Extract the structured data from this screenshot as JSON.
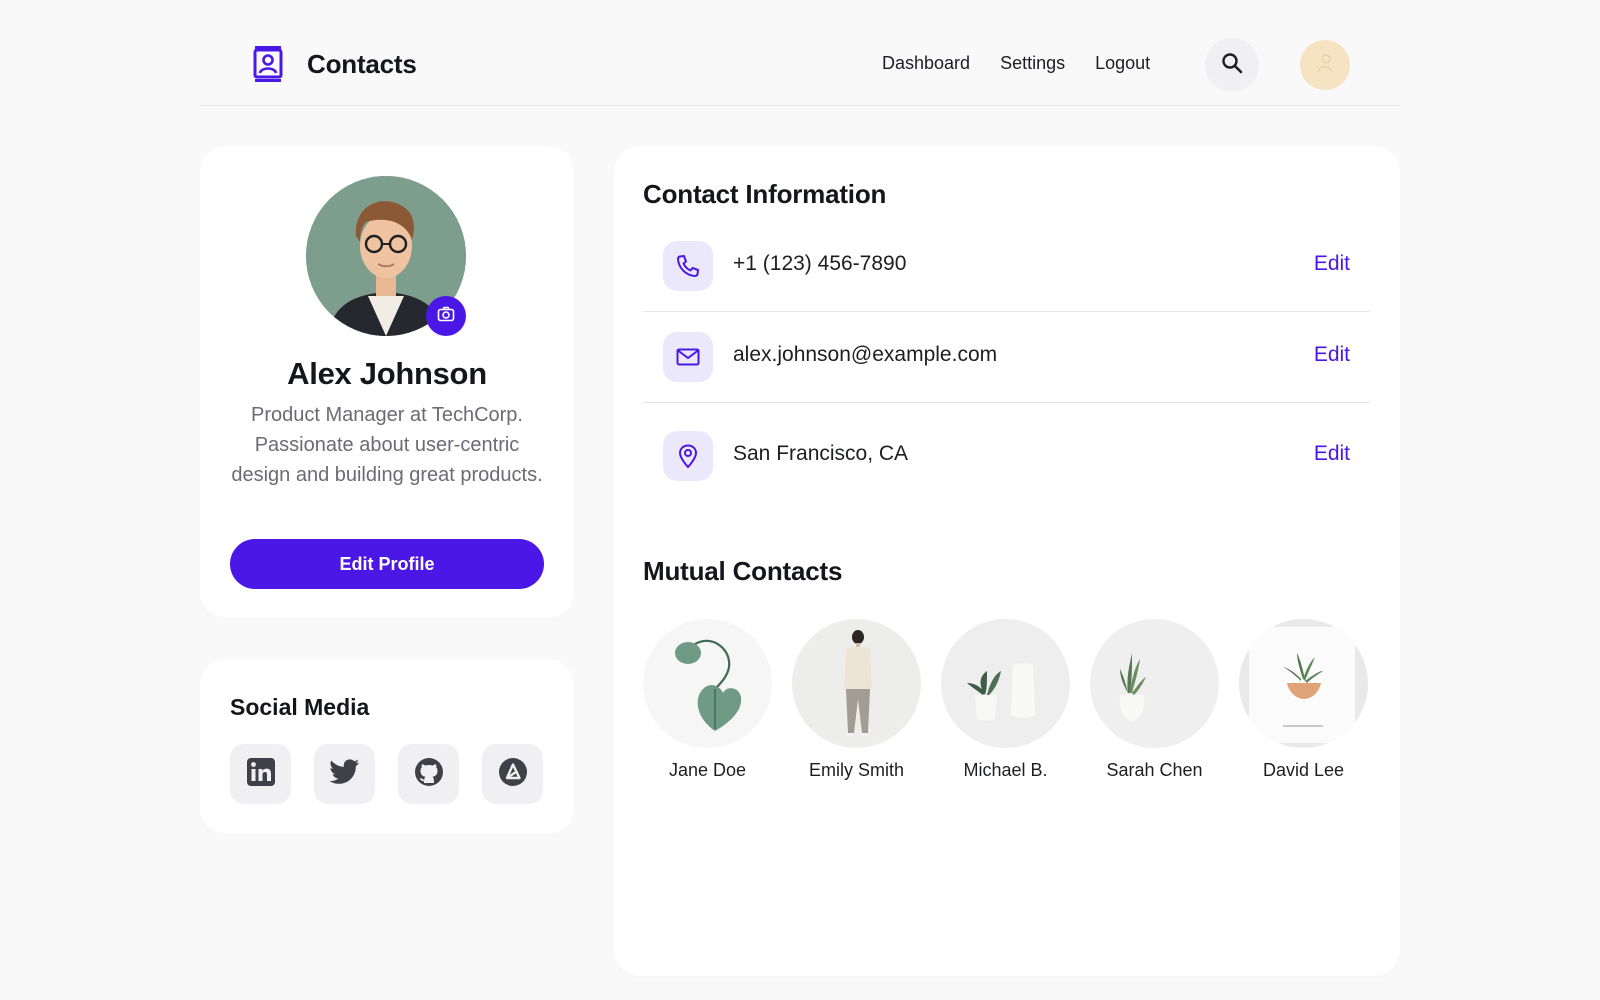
{
  "header": {
    "title": "Contacts",
    "brand_icon": "contact-book-icon",
    "nav": [
      {
        "label": "Dashboard"
      },
      {
        "label": "Settings"
      },
      {
        "label": "Logout"
      }
    ],
    "search_icon": "search-icon",
    "avatar_icon": "user-avatar-icon"
  },
  "profile": {
    "name": "Alex Johnson",
    "bio": "Product Manager at TechCorp. Passionate about user-centric design and building great products.",
    "edit_label": "Edit Profile",
    "camera_icon": "camera-icon"
  },
  "social": {
    "title": "Social Media",
    "icons": [
      "linkedin-icon",
      "twitter-icon",
      "github-icon",
      "link-icon"
    ]
  },
  "contact_info": {
    "title": "Contact Information",
    "rows": [
      {
        "icon": "phone-icon",
        "value": "+1 (123) 456-7890",
        "edit": "Edit"
      },
      {
        "icon": "mail-icon",
        "value": "alex.johnson@example.com",
        "edit": "Edit"
      },
      {
        "icon": "location-icon",
        "value": "San Francisco, CA",
        "edit": "Edit"
      }
    ]
  },
  "mutual": {
    "title": "Mutual Contacts",
    "contacts": [
      {
        "name": "Jane Doe"
      },
      {
        "name": "Emily Smith"
      },
      {
        "name": "Michael B."
      },
      {
        "name": "Sarah Chen"
      },
      {
        "name": "David Lee"
      }
    ]
  },
  "colors": {
    "accent": "#4a17e6",
    "background": "#f9f9f9",
    "card": "#ffffff",
    "icon_bg": "#ece8fb"
  }
}
